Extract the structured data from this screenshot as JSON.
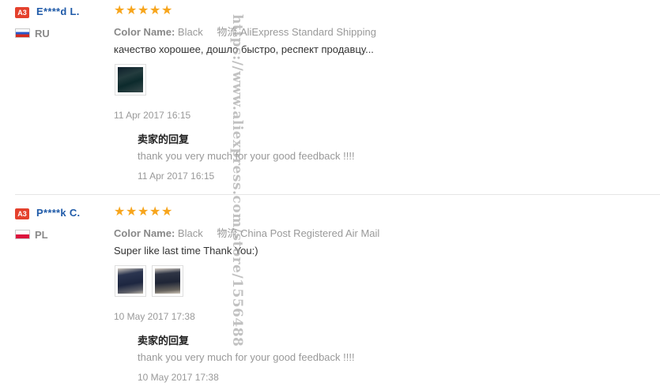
{
  "reviews": [
    {
      "badge": "A3",
      "user": "E****d L.",
      "country": "RU",
      "rating": 5,
      "color_label": "Color Name:",
      "color_value": "Black",
      "shipping_label": "物流",
      "shipping_value": "AliExpress Standard Shipping",
      "comment": "качество хорошее, дошло быстро, респект продавцу...",
      "photo_count": 1,
      "date": "11 Apr 2017 16:15",
      "reply_title": "卖家的回复",
      "reply_text": "thank you very much for your good feedback !!!!",
      "reply_date": "11 Apr 2017 16:15"
    },
    {
      "badge": "A3",
      "user": "P****k C.",
      "country": "PL",
      "rating": 5,
      "color_label": "Color Name:",
      "color_value": "Black",
      "shipping_label": "物流",
      "shipping_value": "China Post Registered Air Mail",
      "comment": "Super like last time Thank You:)",
      "photo_count": 2,
      "date": "10 May 2017 17:38",
      "reply_title": "卖家的回复",
      "reply_text": "thank you very much for your good feedback !!!!",
      "reply_date": "10 May 2017 17:38"
    }
  ],
  "watermark": "https://www.aliexpress.com/store/1556488",
  "colors": {
    "star": "#f7a51c",
    "badge": "#e4412d",
    "username": "#1f5aa8"
  }
}
